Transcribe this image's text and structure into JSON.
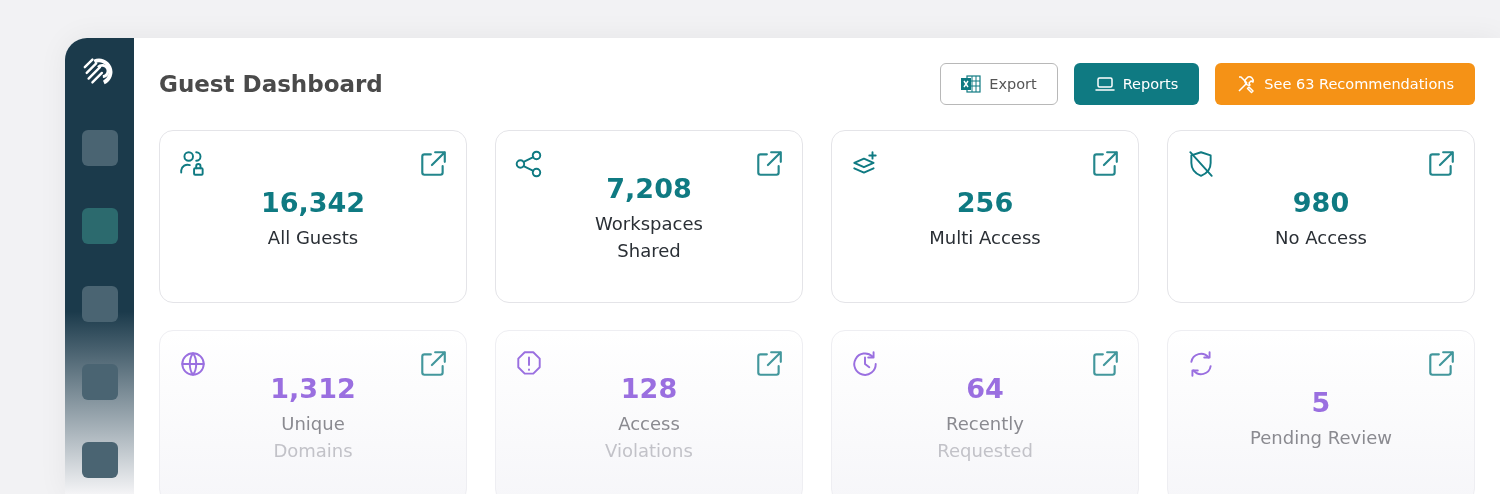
{
  "sidebar": {
    "items": [
      {
        "selected": false
      },
      {
        "selected": true
      },
      {
        "selected": false
      },
      {
        "selected": false
      },
      {
        "selected": false
      }
    ]
  },
  "header": {
    "title": "Guest Dashboard",
    "buttons": [
      {
        "kind": "export",
        "label": "Export"
      },
      {
        "kind": "reports",
        "label": "Reports"
      },
      {
        "kind": "recommendations",
        "label": "See 63 Recommendations"
      }
    ]
  },
  "cards": [
    {
      "kind": "users",
      "value": "16,342",
      "label": [
        "All Guests"
      ],
      "color": "#0f7a82"
    },
    {
      "kind": "share",
      "value": "7,208",
      "label": [
        "Workspaces",
        "Shared"
      ],
      "color": "#0f7a82"
    },
    {
      "kind": "layers",
      "value": "256",
      "label": [
        "Multi Access"
      ],
      "color": "#0f7a82"
    },
    {
      "kind": "shield",
      "value": "980",
      "label": [
        "No Access"
      ],
      "color": "#0f7a82"
    },
    {
      "kind": "globe",
      "value": "1,312",
      "label": [
        "Unique",
        "Domains"
      ],
      "color": "#9a6fe0"
    },
    {
      "kind": "alert",
      "value": "128",
      "label": [
        "Access",
        "Violations"
      ],
      "color": "#9a6fe0"
    },
    {
      "kind": "clock",
      "value": "64",
      "label": [
        "Recently",
        "Requested"
      ],
      "color": "#9a6fe0"
    },
    {
      "kind": "refresh",
      "value": "5",
      "label": [
        "Pending Review"
      ],
      "color": "#9a6fe0"
    }
  ]
}
